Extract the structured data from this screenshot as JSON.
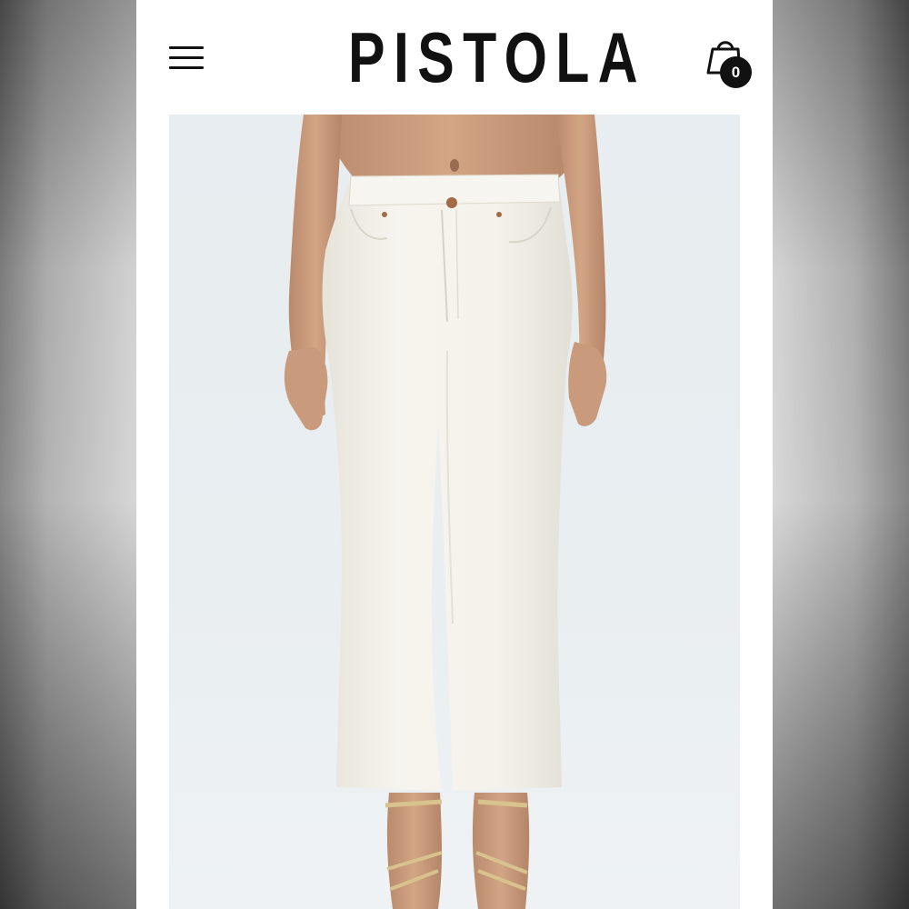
{
  "header": {
    "brand": "PISTOLA",
    "menu_icon": "hamburger-menu-icon",
    "cart_icon": "shopping-bag-icon",
    "cart_count": "0"
  },
  "product": {
    "image_icon": "product-photo-white-flare-jeans"
  },
  "colors": {
    "page_background": "#ffffff",
    "text": "#111111",
    "photo_background": "#e9eef1",
    "denim": "#f3f1ea"
  }
}
